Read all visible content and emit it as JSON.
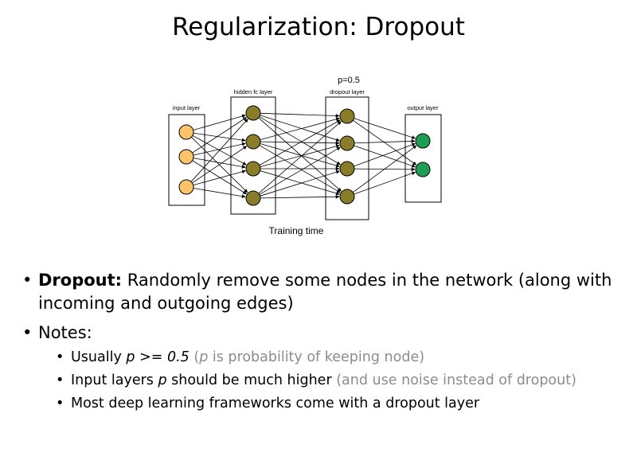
{
  "title": "Regularization: Dropout",
  "diagram": {
    "prob_label": "p=0.5",
    "layers": {
      "input": "input layer",
      "hidden": "hidden fc layer",
      "dropout": "dropout layer",
      "output": "output layer"
    },
    "caption": "Training time",
    "colors": {
      "input_node": "#fcc46a",
      "hidden_node": "#8a7d2a",
      "output_node": "#1e9e55",
      "edge": "#000000"
    }
  },
  "bullets": [
    {
      "bold": "Dropout:",
      "text": " Randomly remove some nodes in the network (along with incoming and outgoing edges)"
    },
    {
      "text": "Notes:",
      "sub": [
        {
          "pre": "Usually ",
          "p": "p",
          "mid": " >= 0.5 ",
          "grey_open": " (",
          "grey_p": "p",
          "grey_rest": " is probability of keeping node)"
        },
        {
          "pre": "Input layers ",
          "p": "p",
          "mid": " should be much higher ",
          "grey": "(and use noise instead of dropout)"
        },
        {
          "text": "Most deep learning frameworks come with a dropout layer"
        }
      ]
    }
  ]
}
